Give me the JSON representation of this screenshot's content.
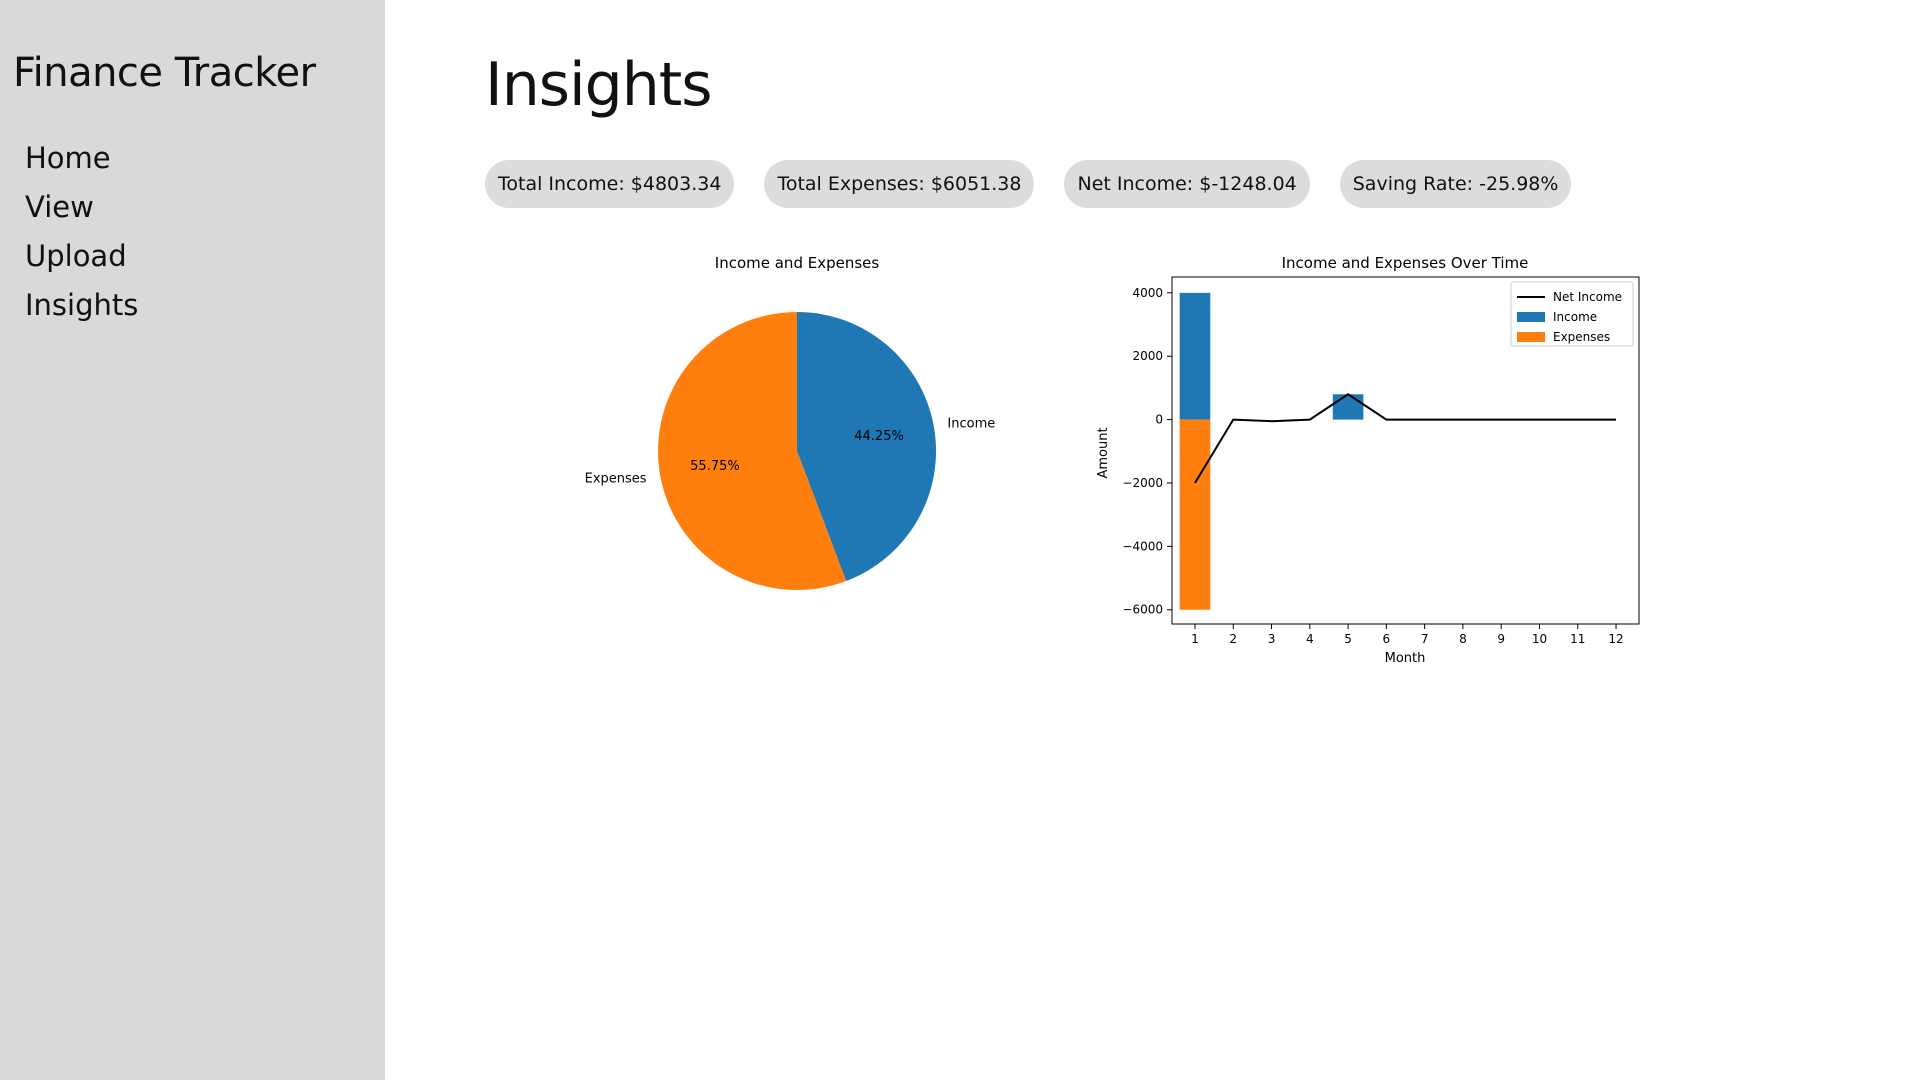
{
  "sidebar": {
    "app_title": "Finance Tracker",
    "nav": [
      {
        "label": "Home"
      },
      {
        "label": "View"
      },
      {
        "label": "Upload"
      },
      {
        "label": "Insights"
      }
    ]
  },
  "main": {
    "page_title": "Insights",
    "stats": {
      "total_income": "Total Income: $4803.34",
      "total_expenses": "Total Expenses: $6051.38",
      "net_income": "Net Income: $-1248.04",
      "saving_rate": "Saving Rate: -25.98%"
    }
  },
  "colors": {
    "income": "#1f77b4",
    "expenses": "#ff7f0e",
    "net_income": "#000000",
    "sidebar_bg": "#d9d9d9",
    "pill_bg": "#dcdcdc"
  },
  "chart_data": [
    {
      "type": "pie",
      "title": "Income and Expenses",
      "labels": [
        "Income",
        "Expenses"
      ],
      "values": [
        44.25,
        55.75
      ],
      "pct_labels": [
        "44.25%",
        "55.75%"
      ],
      "colors": [
        "#1f77b4",
        "#ff7f0e"
      ]
    },
    {
      "type": "bar",
      "title": "Income and Expenses Over Time",
      "xlabel": "Month",
      "ylabel": "Amount",
      "categories": [
        1,
        2,
        3,
        4,
        5,
        6,
        7,
        8,
        9,
        10,
        11,
        12
      ],
      "ylim": [
        -6450,
        4500
      ],
      "yticks": [
        4000,
        2000,
        0,
        -2000,
        -4000,
        -6000
      ],
      "ytick_labels": [
        "4000",
        "2000",
        "0",
        "−2000",
        "−4000",
        "−6000"
      ],
      "legend_position": "top-right",
      "series": [
        {
          "name": "Income",
          "type": "bar",
          "color": "#1f77b4",
          "values": [
            4000,
            0,
            0,
            0,
            800,
            0,
            0,
            0,
            0,
            0,
            0,
            0
          ]
        },
        {
          "name": "Expenses",
          "type": "bar",
          "color": "#ff7f0e",
          "values": [
            -6000,
            0,
            0,
            0,
            0,
            0,
            0,
            0,
            0,
            0,
            0,
            0
          ]
        },
        {
          "name": "Net Income",
          "type": "line",
          "color": "#000000",
          "values": [
            -2000,
            0,
            -50,
            0,
            800,
            0,
            0,
            0,
            0,
            0,
            0,
            0
          ]
        }
      ]
    }
  ]
}
